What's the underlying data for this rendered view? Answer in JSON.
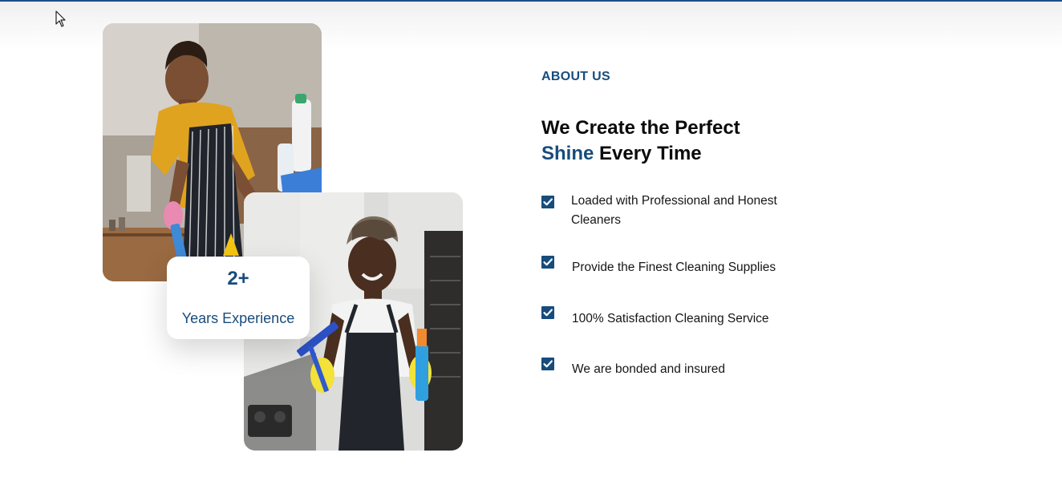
{
  "about": {
    "eyebrow": "ABOUT US",
    "heading_line1": "We Create the Perfect",
    "heading_accent": "Shine",
    "heading_rest": " Every Time"
  },
  "experience": {
    "number": "2+",
    "label": "Years Experience"
  },
  "features": [
    {
      "text": "Loaded with Professional and Honest Cleaners",
      "icon": "checkbox-checked-icon"
    },
    {
      "text": "Provide the Finest Cleaning Supplies",
      "icon": "checkbox-checked-icon"
    },
    {
      "text": "100% Satisfaction Cleaning Service",
      "icon": "checkbox-checked-icon"
    },
    {
      "text": "We are bonded and insured",
      "icon": "checkbox-checked-icon"
    }
  ],
  "colors": {
    "accent": "#184c7c",
    "top_rule": "#1d4f8c"
  },
  "images": {
    "photo_1": "man-cleaning-photo",
    "photo_2": "woman-cleaning-photo"
  }
}
